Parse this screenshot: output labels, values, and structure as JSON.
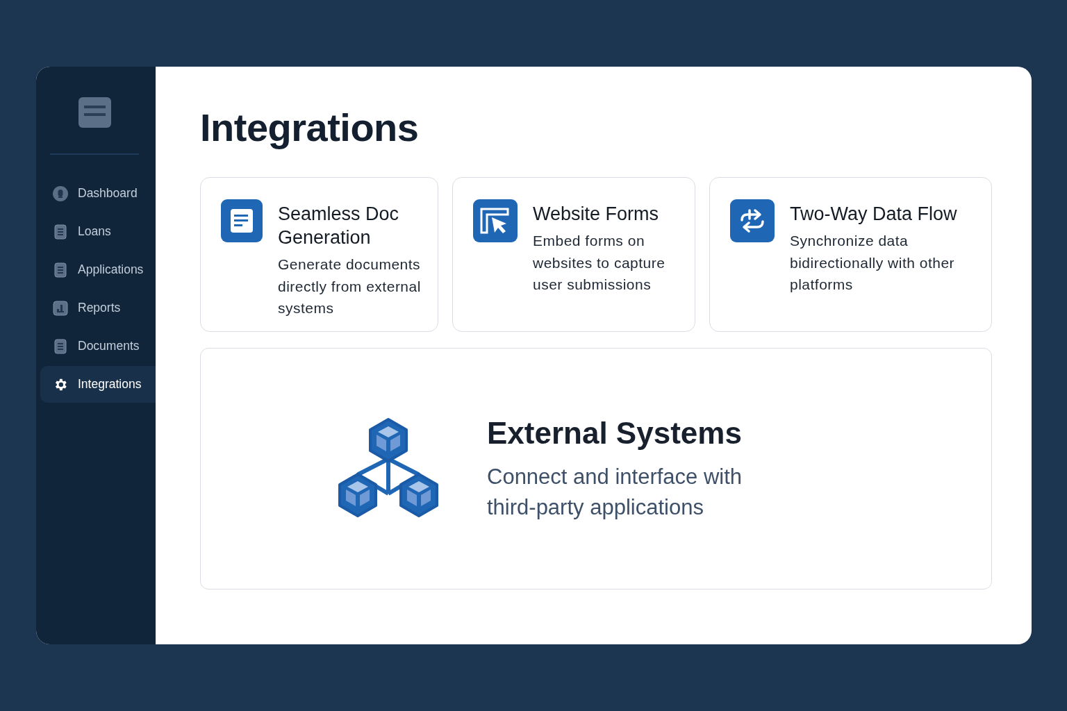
{
  "sidebar": {
    "items": [
      {
        "label": "Dashboard",
        "kind": "dashboard",
        "selected": false
      },
      {
        "label": "Loans",
        "kind": "list",
        "selected": false
      },
      {
        "label": "Applications",
        "kind": "list",
        "selected": false
      },
      {
        "label": "Reports",
        "kind": "chart",
        "selected": false
      },
      {
        "label": "Documents",
        "kind": "list",
        "selected": false
      },
      {
        "label": "Integrations",
        "kind": "gear",
        "selected": true
      }
    ]
  },
  "page": {
    "title": "Integrations"
  },
  "features": [
    {
      "kind": "document",
      "title": "Seamless Doc Generation",
      "description": "Generate documents directly from external systems"
    },
    {
      "kind": "cursor",
      "title": "Website Forms",
      "description": "Embed forms on websites to capture user submissions"
    },
    {
      "kind": "arrows",
      "title": "Two-Way Data Flow",
      "description": "Synchronize data bidirectionally with other platforms"
    }
  ],
  "highlight": {
    "title": "External Systems",
    "description": "Connect and interface with third-party applications"
  }
}
